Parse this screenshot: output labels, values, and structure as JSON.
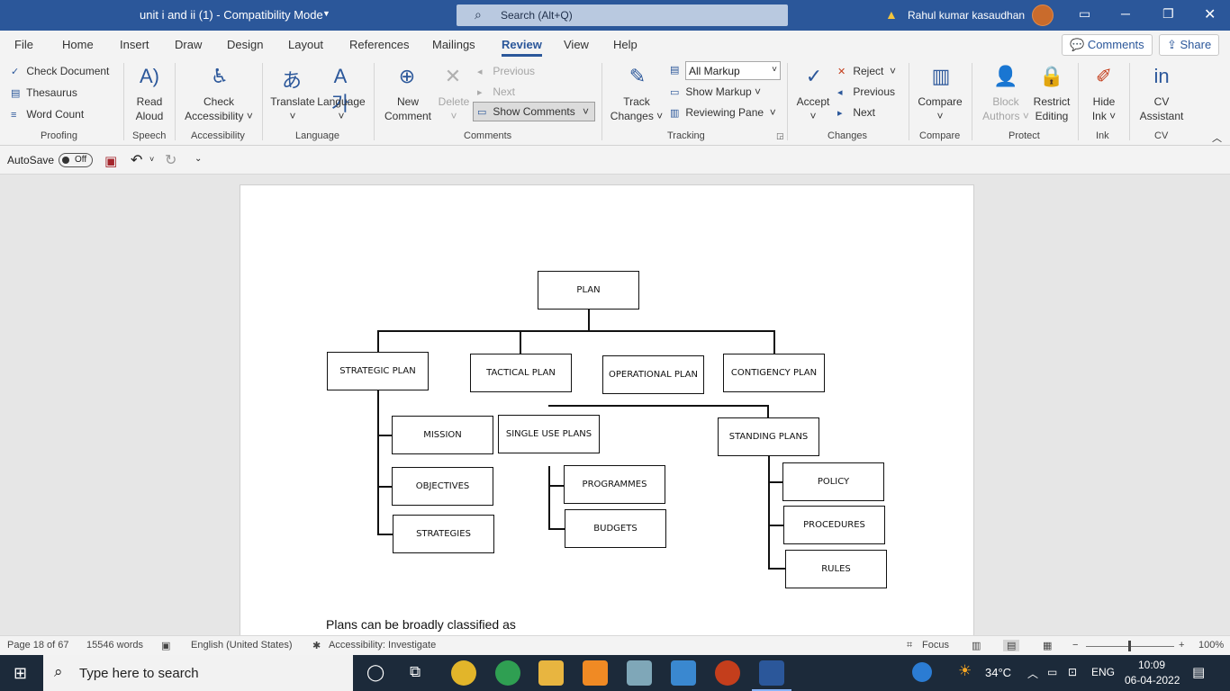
{
  "title_bar": {
    "document_title": "unit i and ii (1)  -  Compatibility Mode",
    "search_placeholder": "Search (Alt+Q)",
    "user_name": "Rahul kumar kasaudhan"
  },
  "menu": {
    "tabs": [
      "File",
      "Home",
      "Insert",
      "Draw",
      "Design",
      "Layout",
      "References",
      "Mailings",
      "Review",
      "View",
      "Help"
    ],
    "active_tab": "Review",
    "comments_label": "Comments",
    "share_label": "Share"
  },
  "ribbon": {
    "proofing": {
      "check_document": "Check Document",
      "thesaurus": "Thesaurus",
      "word_count": "Word Count",
      "label": "Proofing"
    },
    "speech": {
      "read_aloud_1": "Read",
      "read_aloud_2": "Aloud",
      "label": "Speech"
    },
    "accessibility": {
      "check_1": "Check",
      "check_2": "Accessibility",
      "label": "Accessibility"
    },
    "language": {
      "translate": "Translate",
      "language": "Language",
      "label": "Language"
    },
    "comments": {
      "new_1": "New",
      "new_2": "Comment",
      "delete": "Delete",
      "previous": "Previous",
      "next": "Next",
      "show_comments": "Show Comments",
      "label": "Comments"
    },
    "tracking": {
      "track_1": "Track",
      "track_2": "Changes",
      "markup_value": "All Markup",
      "show_markup": "Show Markup",
      "reviewing_pane": "Reviewing Pane",
      "label": "Tracking"
    },
    "changes": {
      "accept": "Accept",
      "reject": "Reject",
      "previous": "Previous",
      "next": "Next",
      "label": "Changes"
    },
    "compare": {
      "compare": "Compare",
      "label": "Compare"
    },
    "protect": {
      "block_1": "Block",
      "block_2": "Authors",
      "restrict_1": "Restrict",
      "restrict_2": "Editing",
      "label": "Protect"
    },
    "ink": {
      "hide_1": "Hide",
      "hide_2": "Ink",
      "label": "Ink"
    },
    "cv": {
      "cv_1": "CV",
      "cv_2": "Assistant",
      "label": "CV"
    }
  },
  "quick_access": {
    "autosave_label": "AutoSave",
    "autosave_state": "Off"
  },
  "document": {
    "diagram": {
      "root": "PLAN",
      "level1": [
        "STRATEGIC PLAN",
        "TACTICAL PLAN",
        "OPERATIONAL PLAN",
        "CONTIGENCY PLAN"
      ],
      "strategic_children": [
        "MISSION",
        "OBJECTIVES",
        "STRATEGIES"
      ],
      "operational_children": [
        "SINGLE USE PLANS",
        "STANDING PLANS"
      ],
      "single_use_children": [
        "PROGRAMMES",
        "BUDGETS"
      ],
      "standing_children": [
        "POLICY",
        "PROCEDURES",
        "RULES"
      ]
    },
    "body_text": "Plans can be broadly classified as"
  },
  "status_bar": {
    "page": "Page 18 of 67",
    "words": "15546 words",
    "language": "English (United States)",
    "accessibility": "Accessibility: Investigate",
    "focus": "Focus",
    "zoom": "100%"
  },
  "taskbar": {
    "search_placeholder": "Type here to search",
    "temperature": "34°C",
    "language": "ENG",
    "time": "10:09",
    "date": "06-04-2022"
  }
}
